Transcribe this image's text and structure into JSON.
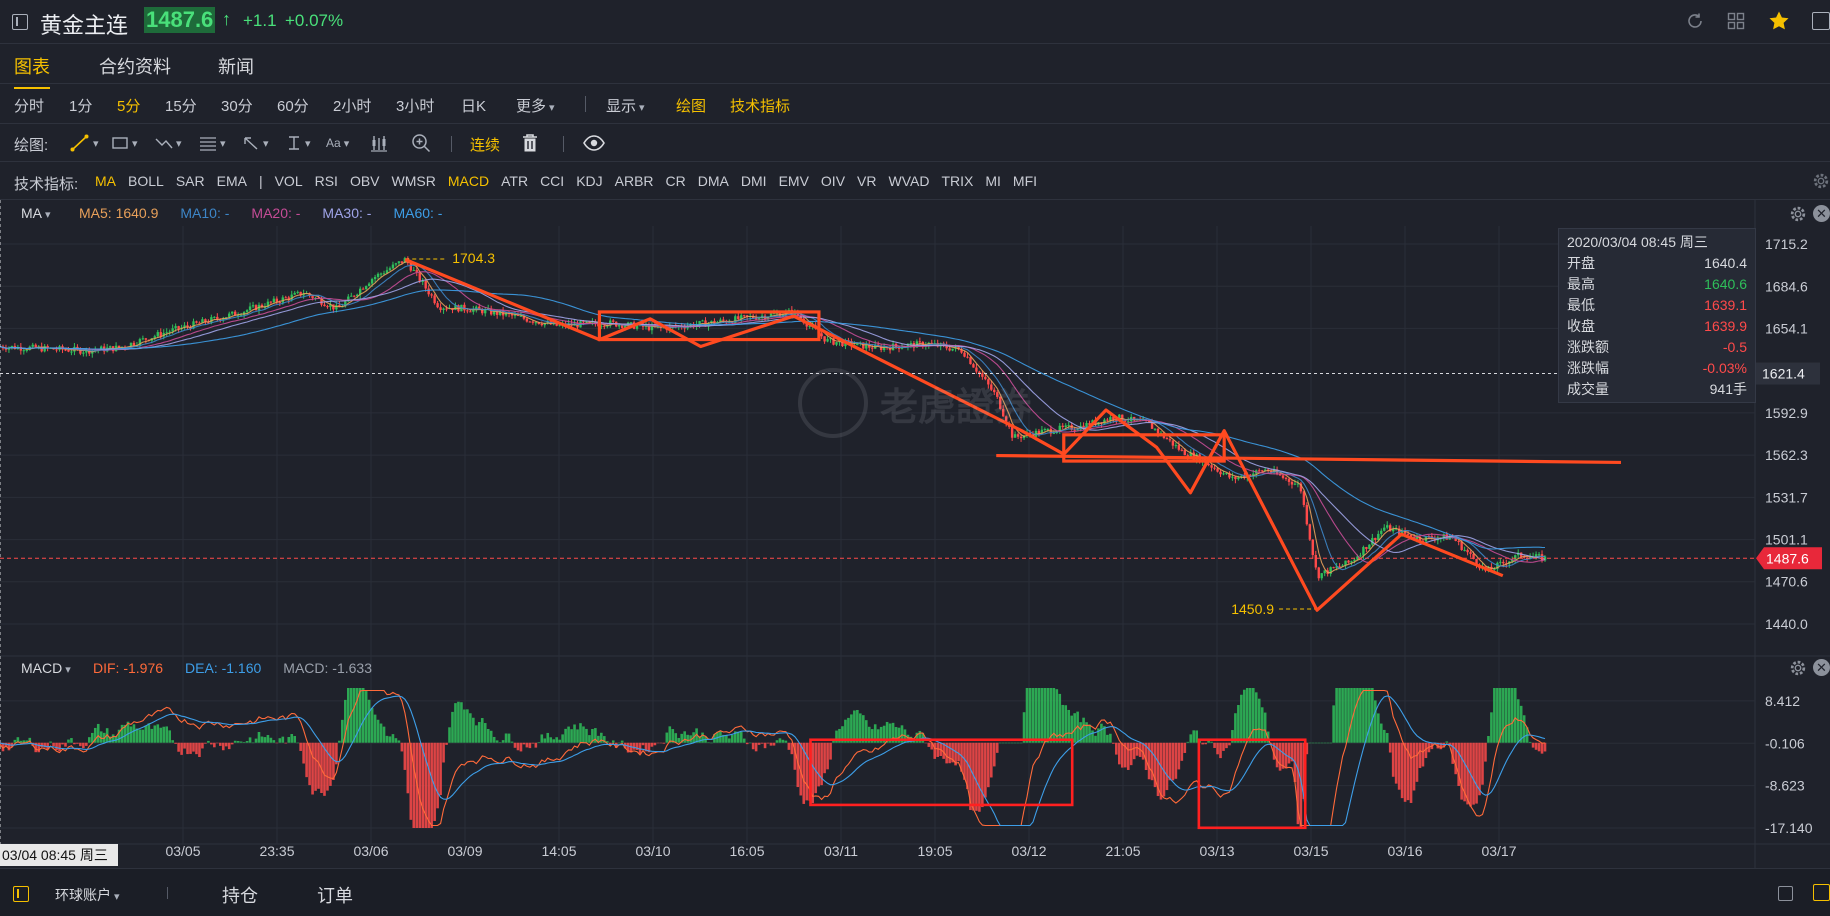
{
  "header": {
    "title": "黄金主连",
    "price": "1487.6",
    "price_arrow": "↑",
    "change": "+1.1",
    "change_pct": "+0.07%"
  },
  "tabs": [
    {
      "label": "图表",
      "active": true
    },
    {
      "label": "合约资料",
      "active": false
    },
    {
      "label": "新闻",
      "active": false
    }
  ],
  "periods": [
    {
      "label": "分时",
      "active": false
    },
    {
      "label": "1分",
      "active": false
    },
    {
      "label": "5分",
      "active": true
    },
    {
      "label": "15分",
      "active": false
    },
    {
      "label": "30分",
      "active": false
    },
    {
      "label": "60分",
      "active": false
    },
    {
      "label": "2小时",
      "active": false
    },
    {
      "label": "3小时",
      "active": false
    },
    {
      "label": "日K",
      "active": false
    }
  ],
  "period_more": "更多",
  "display_menu": "显示",
  "draw_link": "绘图",
  "indicator_link": "技术指标",
  "drawbar": {
    "label": "绘图:",
    "text_tool": "Aa",
    "continuous": "连续"
  },
  "indicators": {
    "label": "技术指标:",
    "items": [
      {
        "label": "MA",
        "active": true
      },
      {
        "label": "BOLL",
        "active": false
      },
      {
        "label": "SAR",
        "active": false
      },
      {
        "label": "EMA",
        "active": false
      },
      {
        "label": "|",
        "active": false
      },
      {
        "label": "VOL",
        "active": false
      },
      {
        "label": "RSI",
        "active": false
      },
      {
        "label": "OBV",
        "active": false
      },
      {
        "label": "WMSR",
        "active": false
      },
      {
        "label": "MACD",
        "active": true
      },
      {
        "label": "ATR",
        "active": false
      },
      {
        "label": "CCI",
        "active": false
      },
      {
        "label": "KDJ",
        "active": false
      },
      {
        "label": "ARBR",
        "active": false
      },
      {
        "label": "CR",
        "active": false
      },
      {
        "label": "DMA",
        "active": false
      },
      {
        "label": "DMI",
        "active": false
      },
      {
        "label": "EMV",
        "active": false
      },
      {
        "label": "OIV",
        "active": false
      },
      {
        "label": "VR",
        "active": false
      },
      {
        "label": "WVAD",
        "active": false
      },
      {
        "label": "TRIX",
        "active": false
      },
      {
        "label": "MI",
        "active": false
      },
      {
        "label": "MFI",
        "active": false
      }
    ]
  },
  "ma_legend": {
    "selector": "MA",
    "items": [
      {
        "label": "MA5: 1640.9",
        "color": "#e8a05a"
      },
      {
        "label": "MA10: -",
        "color": "#3d86c8"
      },
      {
        "label": "MA20: -",
        "color": "#c54c96"
      },
      {
        "label": "MA30: -",
        "color": "#9fa4e8"
      },
      {
        "label": "MA60: -",
        "color": "#3d9ee8"
      }
    ]
  },
  "macd_legend": {
    "selector": "MACD",
    "items": [
      {
        "label": "DIF: -1.976",
        "color": "#ff6a3a"
      },
      {
        "label": "DEA: -1.160",
        "color": "#3d9ee8"
      },
      {
        "label": "MACD: -1.633",
        "color": "#9aa0ab"
      }
    ]
  },
  "tooltip": {
    "date": "2020/03/04 08:45 周三",
    "rows": [
      {
        "label": "开盘",
        "value": "1640.4",
        "color": "#d7d9de"
      },
      {
        "label": "最高",
        "value": "1640.6",
        "color": "#2fbf5a"
      },
      {
        "label": "最低",
        "value": "1639.1",
        "color": "#ff4a4a"
      },
      {
        "label": "收盘",
        "value": "1639.9",
        "color": "#ff4a4a"
      },
      {
        "label": "涨跌额",
        "value": "-0.5",
        "color": "#ff4a4a"
      },
      {
        "label": "涨跌幅",
        "value": "-0.03%",
        "color": "#ff4a4a"
      },
      {
        "label": "成交量",
        "value": "941手",
        "color": "#d7d9de"
      }
    ]
  },
  "watermark": "老虎證券",
  "crosshair_time": "03/04 08:45 周三",
  "bottombar": {
    "account": "环球账户",
    "positions": "持仓",
    "orders": "订单"
  },
  "colors": {
    "accent": "#f5c000",
    "up": "#2fbf5a",
    "down": "#ff4a4a",
    "annotation": "#ff4a20"
  },
  "chart_data": {
    "type": "candlestick",
    "interval": "5分",
    "price_ticks": [
      1715.2,
      1684.6,
      1654.1,
      1623.5,
      1592.9,
      1562.3,
      1531.7,
      1501.1,
      1470.6,
      1440.0
    ],
    "price_tick_labels": [
      "1715.2",
      "1684.6",
      "1654.1",
      "1592.9",
      "1562.3",
      "1531.7",
      "1501.1",
      "1470.6",
      "1440.0"
    ],
    "ylim": [
      1440.0,
      1715.2
    ],
    "crosshair_price": "1621.4",
    "last_price": "1487.6",
    "high_marker": "1704.3",
    "low_marker": "1450.9",
    "x_tick_labels": [
      "03/05",
      "23:35",
      "03/06",
      "03/09",
      "14:05",
      "03/10",
      "16:05",
      "03/11",
      "19:05",
      "03/12",
      "21:05",
      "03/13",
      "03/15",
      "03/16",
      "03/17"
    ],
    "price_path": [
      [
        0,
        1641
      ],
      [
        0.05,
        1638
      ],
      [
        0.07,
        1640
      ],
      [
        0.1,
        1652
      ],
      [
        0.14,
        1665
      ],
      [
        0.18,
        1680
      ],
      [
        0.2,
        1668
      ],
      [
        0.22,
        1690
      ],
      [
        0.24,
        1704
      ],
      [
        0.26,
        1670
      ],
      [
        0.28,
        1668
      ],
      [
        0.3,
        1664
      ],
      [
        0.33,
        1656
      ],
      [
        0.36,
        1658
      ],
      [
        0.39,
        1654
      ],
      [
        0.42,
        1658
      ],
      [
        0.45,
        1663
      ],
      [
        0.47,
        1666
      ],
      [
        0.49,
        1645
      ],
      [
        0.52,
        1640
      ],
      [
        0.55,
        1643
      ],
      [
        0.57,
        1638
      ],
      [
        0.59,
        1605
      ],
      [
        0.6,
        1575
      ],
      [
        0.62,
        1580
      ],
      [
        0.64,
        1583
      ],
      [
        0.66,
        1590
      ],
      [
        0.68,
        1585
      ],
      [
        0.7,
        1565
      ],
      [
        0.71,
        1560
      ],
      [
        0.73,
        1545
      ],
      [
        0.75,
        1552
      ],
      [
        0.77,
        1540
      ],
      [
        0.78,
        1475
      ],
      [
        0.8,
        1485
      ],
      [
        0.82,
        1510
      ],
      [
        0.84,
        1502
      ],
      [
        0.86,
        1503
      ],
      [
        0.88,
        1478
      ],
      [
        0.9,
        1490
      ],
      [
        0.915,
        1487.6
      ]
    ],
    "macd_ticks": [
      8.412,
      -0.106,
      -8.623,
      -17.14
    ],
    "macd_tick_labels": [
      "8.412",
      "-0.106",
      "-8.623",
      "-17.140"
    ],
    "macd_ylim": [
      -17.14,
      11.0
    ]
  }
}
